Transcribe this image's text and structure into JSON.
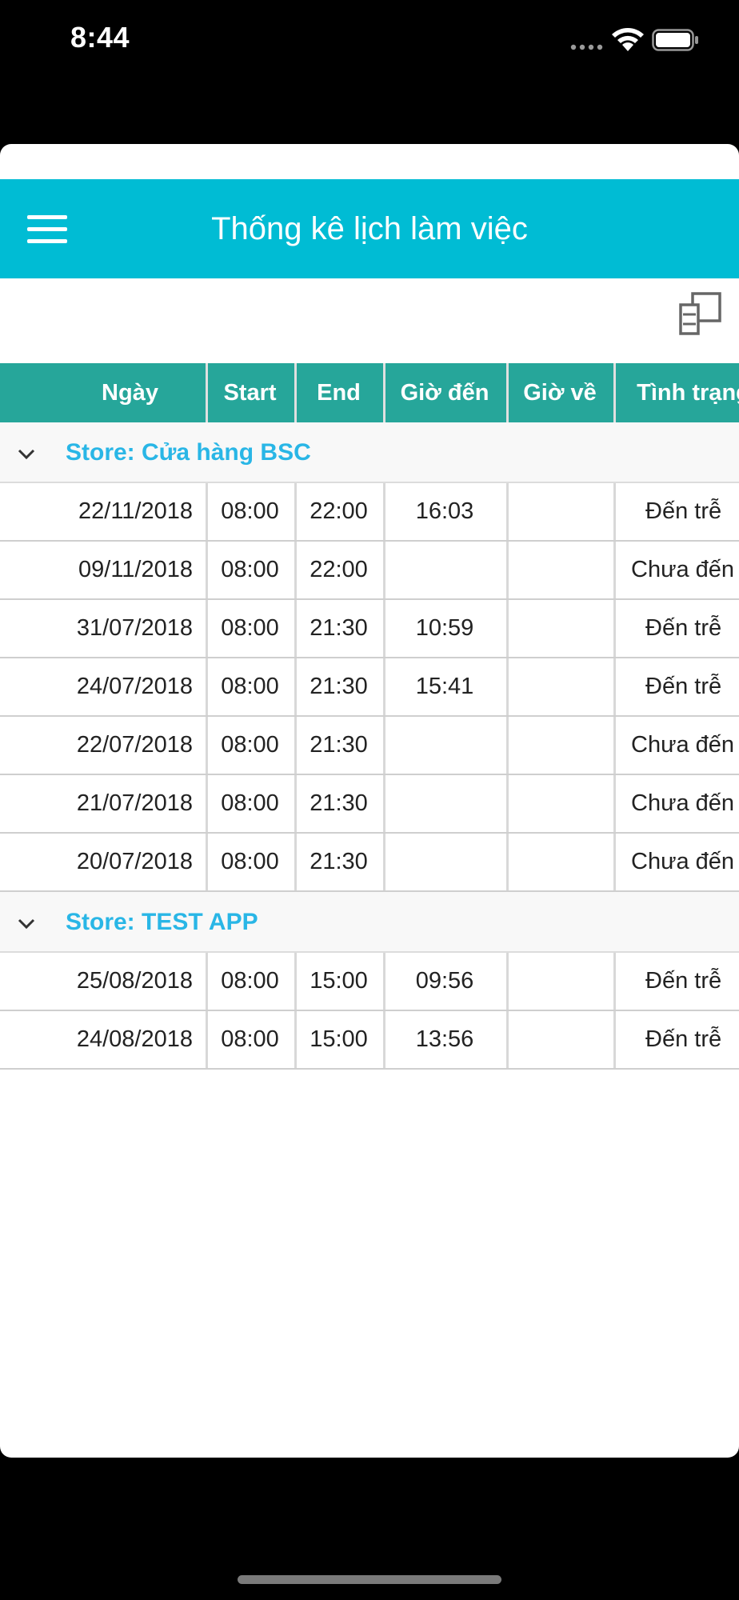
{
  "status_bar": {
    "time": "8:44"
  },
  "app_bar": {
    "title": "Thống kê lịch làm việc",
    "menu_icon": "hamburger-menu-icon",
    "color": "#00bcd4"
  },
  "toolbar": {
    "layout_icon": "layout-toggle-icon"
  },
  "table": {
    "header_color": "#26a69a",
    "group_label_color": "#29b6e6",
    "columns": [
      "Ngày",
      "Start",
      "End",
      "Giờ đến",
      "Giờ về",
      "Tình trạng"
    ],
    "groups": [
      {
        "label": "Store: Cửa hàng BSC",
        "rows": [
          {
            "date": "22/11/2018",
            "start": "08:00",
            "end": "22:00",
            "checkin": "16:03",
            "checkout": "",
            "status": "Đến trễ"
          },
          {
            "date": "09/11/2018",
            "start": "08:00",
            "end": "22:00",
            "checkin": "",
            "checkout": "",
            "status": "Chưa đến"
          },
          {
            "date": "31/07/2018",
            "start": "08:00",
            "end": "21:30",
            "checkin": "10:59",
            "checkout": "",
            "status": "Đến trễ"
          },
          {
            "date": "24/07/2018",
            "start": "08:00",
            "end": "21:30",
            "checkin": "15:41",
            "checkout": "",
            "status": "Đến trễ"
          },
          {
            "date": "22/07/2018",
            "start": "08:00",
            "end": "21:30",
            "checkin": "",
            "checkout": "",
            "status": "Chưa đến"
          },
          {
            "date": "21/07/2018",
            "start": "08:00",
            "end": "21:30",
            "checkin": "",
            "checkout": "",
            "status": "Chưa đến"
          },
          {
            "date": "20/07/2018",
            "start": "08:00",
            "end": "21:30",
            "checkin": "",
            "checkout": "",
            "status": "Chưa đến"
          }
        ]
      },
      {
        "label": "Store: TEST APP",
        "rows": [
          {
            "date": "25/08/2018",
            "start": "08:00",
            "end": "15:00",
            "checkin": "09:56",
            "checkout": "",
            "status": "Đến trễ"
          },
          {
            "date": "24/08/2018",
            "start": "08:00",
            "end": "15:00",
            "checkin": "13:56",
            "checkout": "",
            "status": "Đến trễ"
          }
        ]
      }
    ]
  }
}
